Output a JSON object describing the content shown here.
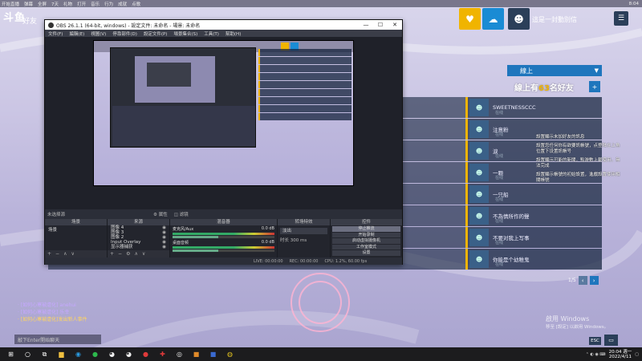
{
  "top_strip": {
    "items": [
      "开始直播",
      "弹幕",
      "全屏",
      "7天",
      "礼物",
      "打开",
      "音乐",
      "行为",
      "成就",
      "点歌"
    ],
    "right": "8:04"
  },
  "header": {
    "logo": "斗鱼",
    "friends_tab": "好友",
    "back_label": "這是一封動別信",
    "version": "BETA 4.0",
    "tiles": [
      {
        "name": "gift",
        "color": "#f0b400",
        "glyph": "♥"
      },
      {
        "name": "cloud",
        "color": "#1a8bd4",
        "glyph": "☁"
      },
      {
        "name": "avatar",
        "color": "#2b3f59",
        "glyph": "☻"
      }
    ],
    "menu_glyph": "☰"
  },
  "online": {
    "status": "線上",
    "count_prefix": "線上有",
    "count": "63",
    "count_suffix": "名好友",
    "add_glyph": "+"
  },
  "friends": [
    {
      "name": "SWEETNESSCCC",
      "status": "在线"
    },
    {
      "name": "注意粉",
      "status": "在线"
    },
    {
      "name": "淚",
      "status": "在线"
    },
    {
      "name": "一颗",
      "status": "在线"
    },
    {
      "name": "一只船",
      "status": "在线"
    },
    {
      "name": "不為情所作的聲",
      "status": "在线"
    },
    {
      "name": "不要对我上写事",
      "status": "在线"
    },
    {
      "name": "你能是个幼稚鬼",
      "status": "在线"
    }
  ],
  "tips": [
    "設置顯示未加好友的訊息",
    "設置您任何你有欲要訊帳號，点登陆在上角位置下设置訊帳号",
    "設置顯示可能的新聞，點游數上載使用，無法完成",
    "設置顯示帳號的初始設置，進戲設置使用相關帳號"
  ],
  "pager": {
    "text": "1/5",
    "prev": "‹",
    "next": "›"
  },
  "chat": [
    {
      "text": "· [如何心寒被虐化] anehui",
      "color": "#c6a8ff"
    },
    {
      "text": "· [如何心寒被虐化] 乐幸",
      "color": "#c6a8ff"
    },
    {
      "text": "· [如何心寒被虐化]发出新人事件",
      "color": "#ffd55e"
    }
  ],
  "chat_input_placeholder": "敲下Enter開始聊天",
  "activate": {
    "title": "啟用 Windows",
    "sub": "移至 [設定] 以啟用 Windows。"
  },
  "esc": "ESC",
  "obs": {
    "title": "OBS 26.1.1 (64-bit, windows) - 設定文件: 未命名 - 場景: 未命名",
    "menu": [
      "文件(F)",
      "編輯(E)",
      "視圖(V)",
      "停靠部件(D)",
      "設定文件(P)",
      "場景集合(S)",
      "工具(T)",
      "幫助(H)"
    ],
    "window_controls": [
      "—",
      "☐",
      "✕"
    ],
    "no_source": "未选择源",
    "bar_buttons": [
      "⚙ 属性",
      "◫ 滤镜"
    ],
    "docks": {
      "scenes": {
        "title": "场景",
        "items": [
          "场景"
        ]
      },
      "sources": {
        "title": "来源",
        "items": [
          "图像 4",
          "图像 3",
          "图像 2",
          "Input Overlay",
          "显示器捕获"
        ]
      },
      "mixer": {
        "title": "混音器",
        "channels": [
          {
            "name": "麦克风/Aux",
            "db": "0.0 dB"
          },
          {
            "name": "桌面音频",
            "db": "0.0 dB"
          }
        ]
      },
      "transitions": {
        "title": "转场特效",
        "selected": "淡出",
        "duration_label": "时长",
        "duration": "300 ms"
      },
      "controls": {
        "title": "控件",
        "buttons": [
          "停止推流",
          "开始录制",
          "启动虚拟摄像机",
          "工作室模式",
          "设置",
          "退出"
        ]
      }
    },
    "status": [
      "LIVE: 00:00:00",
      "REC: 00:00:00",
      "CPU: 1.2%, 60.00 fps"
    ],
    "foot_glyphs": [
      "+",
      "−",
      "∧",
      "∨"
    ]
  },
  "taskbar": {
    "icons": [
      {
        "name": "windows",
        "glyph": "⊞",
        "color": "#fff"
      },
      {
        "name": "search",
        "glyph": "○",
        "color": "#fff"
      },
      {
        "name": "taskview",
        "glyph": "⧉",
        "color": "#fff"
      },
      {
        "name": "explorer",
        "glyph": "▆",
        "color": "#f0c040"
      },
      {
        "name": "edge",
        "glyph": "◉",
        "color": "#2a9ae0"
      },
      {
        "name": "wechat",
        "glyph": "●",
        "color": "#2db84c"
      },
      {
        "name": "qq",
        "glyph": "◕",
        "color": "#eee"
      },
      {
        "name": "qq2",
        "glyph": "◕",
        "color": "#eee"
      },
      {
        "name": "netease",
        "glyph": "●",
        "color": "#e03a3a"
      },
      {
        "name": "app",
        "glyph": "✚",
        "color": "#e03a3a"
      },
      {
        "name": "obs",
        "glyph": "◎",
        "color": "#eee"
      },
      {
        "name": "game",
        "glyph": "■",
        "color": "#e08a2a"
      },
      {
        "name": "app3",
        "glyph": "■",
        "color": "#3a6ad0"
      },
      {
        "name": "chrome",
        "glyph": "◍",
        "color": "#e0c020"
      }
    ],
    "time": "20:04 週一",
    "date": "2022/4/11"
  }
}
